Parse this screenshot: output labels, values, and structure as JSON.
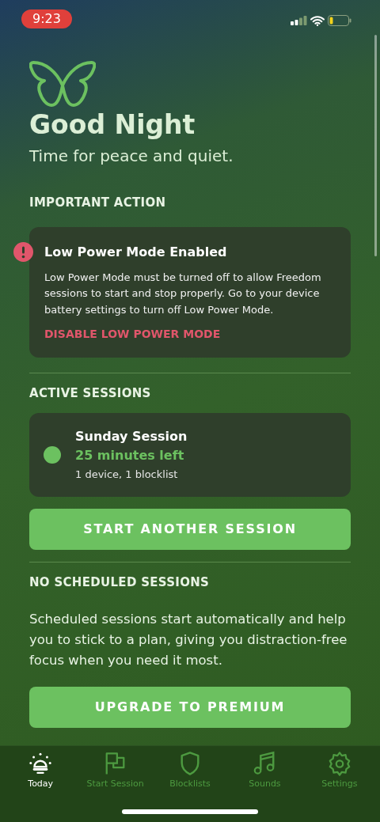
{
  "status_bar": {
    "time": "9:23"
  },
  "header": {
    "title": "Good Night",
    "subtitle": "Time for peace and quiet."
  },
  "important": {
    "heading": "IMPORTANT ACTION",
    "alert": {
      "title": "Low Power Mode Enabled",
      "body": "Low Power Mode must be turned off to allow Freedom sessions to start and stop properly. Go to your device battery settings to turn off Low Power Mode.",
      "action": "DISABLE LOW POWER MODE"
    }
  },
  "active": {
    "heading": "ACTIVE SESSIONS",
    "sessions": [
      {
        "name": "Sunday Session",
        "remaining": "25 minutes left",
        "details": "1 device, 1 blocklist",
        "color": "#6cc160"
      }
    ],
    "button": "START ANOTHER SESSION"
  },
  "scheduled": {
    "heading": "NO SCHEDULED SESSIONS",
    "text": "Scheduled sessions start automatically and help you to stick to a plan, giving you distraction-free focus when you need it most.",
    "button": "UPGRADE TO PREMIUM"
  },
  "tabs": [
    {
      "label": "Today",
      "selected": true
    },
    {
      "label": "Start Session",
      "selected": false
    },
    {
      "label": "Blocklists",
      "selected": false
    },
    {
      "label": "Sounds",
      "selected": false
    },
    {
      "label": "Settings",
      "selected": false
    }
  ]
}
